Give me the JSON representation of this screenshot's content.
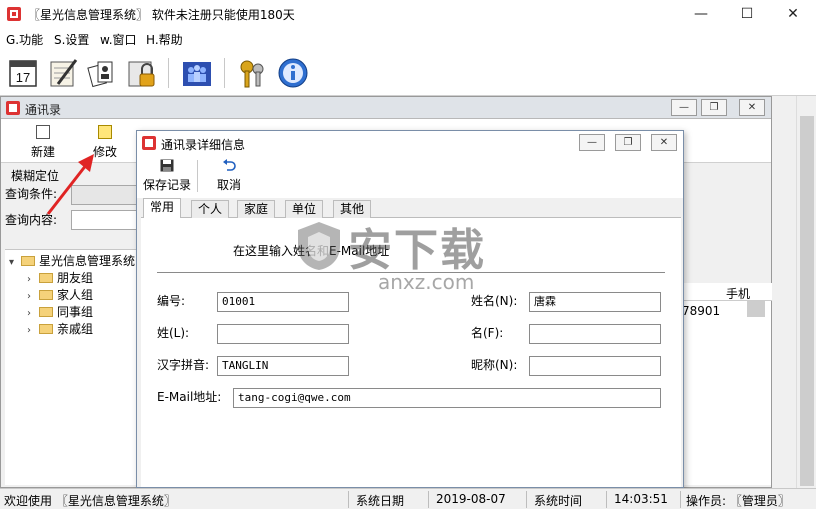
{
  "app": {
    "title": "〖星光信息管理系统〗 软件未注册只能使用180天"
  },
  "menu": {
    "items": [
      "G.功能",
      "S.设置",
      "w.窗口",
      "H.帮助"
    ]
  },
  "toolbar": {
    "icons": [
      "calendar-icon",
      "notepad-icon",
      "cards-icon",
      "lock-icon",
      "users-icon",
      "keys-icon",
      "info-icon"
    ],
    "calendar_day": "17"
  },
  "child_window": {
    "title": "通讯录",
    "toolbar": {
      "new_label": "新建",
      "edit_label": "修改"
    },
    "fuzzy_label": "模糊定位",
    "query_condition_label": "查询条件:",
    "query_content_label": "查询内容:",
    "tree": {
      "root": "星光信息管理系统",
      "groups": [
        "朋友组",
        "家人组",
        "同事组",
        "亲戚组"
      ]
    },
    "grid": {
      "header": "手机",
      "row1": "78901"
    }
  },
  "dialog": {
    "title": "通讯录详细信息",
    "save_label": "保存记录",
    "cancel_label": "取消",
    "tabs": [
      "常用",
      "个人",
      "家庭",
      "单位",
      "其他"
    ],
    "hint": "在这里输入姓名和E-Mail地址",
    "fields": {
      "number_label": "编号:",
      "number_value": "01001",
      "name_label": "姓名(N):",
      "name_value": "唐霖",
      "surname_label": "姓(L):",
      "surname_value": "",
      "given_label": "名(F):",
      "given_value": "",
      "pinyin_label": "汉字拼音:",
      "pinyin_value": "TANGLIN",
      "nickname_label": "昵称(N):",
      "nickname_value": "",
      "email_label": "E-Mail地址:",
      "email_value": "tang-cogi@qwe.com"
    }
  },
  "statusbar": {
    "welcome": "欢迎使用 〖星光信息管理系统〗",
    "date_label": "系统日期",
    "date_value": "2019-08-07",
    "time_label": "系统时间",
    "time_value": "14:03:51",
    "operator_label": "操作员: 〖管理员〗"
  },
  "watermark": {
    "text": "安下载",
    "sub": "anxz.com"
  },
  "colors": {
    "accent": "#1f5fbf",
    "arrow": "#e02424",
    "folder": "#f5d27a"
  }
}
